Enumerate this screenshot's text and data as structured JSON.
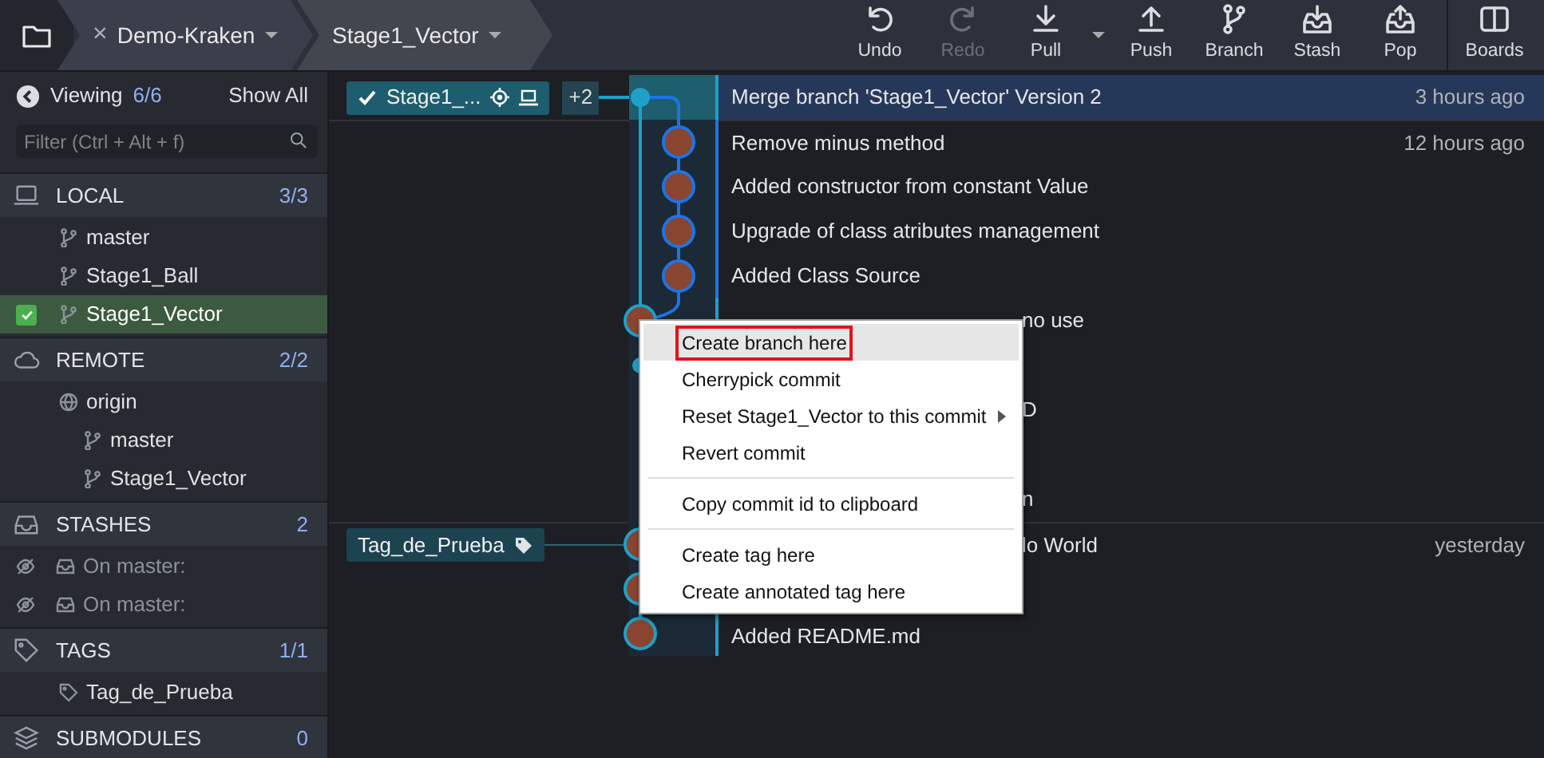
{
  "toolbar": {
    "repo_tab": {
      "close": "×",
      "label": "Demo-Kraken"
    },
    "branch_tab": {
      "label": "Stage1_Vector"
    },
    "actions": [
      {
        "kind": "undo",
        "label": "Undo",
        "disabled": false,
        "menu": false
      },
      {
        "kind": "redo",
        "label": "Redo",
        "disabled": true,
        "menu": false
      },
      {
        "kind": "pull",
        "label": "Pull",
        "disabled": false,
        "menu": true
      },
      {
        "kind": "push",
        "label": "Push",
        "disabled": false,
        "menu": false
      },
      {
        "kind": "branch",
        "label": "Branch",
        "disabled": false,
        "menu": false
      },
      {
        "kind": "stash",
        "label": "Stash",
        "disabled": false,
        "menu": false
      },
      {
        "kind": "pop",
        "label": "Pop",
        "disabled": false,
        "menu": false
      },
      {
        "kind": "boards",
        "label": "Boards",
        "disabled": false,
        "menu": false
      }
    ]
  },
  "sidebar": {
    "viewing": {
      "label": "Viewing",
      "count": "6/6",
      "action": "Show All"
    },
    "filter": {
      "placeholder": "Filter (Ctrl + Alt + f)"
    },
    "sections": [
      {
        "kind": "local",
        "title": "LOCAL",
        "count": "3/3",
        "items": [
          {
            "kind": "branch",
            "label": "master",
            "selected": false
          },
          {
            "kind": "branch",
            "label": "Stage1_Ball",
            "selected": false
          },
          {
            "kind": "branch",
            "label": "Stage1_Vector",
            "selected": true
          }
        ]
      },
      {
        "kind": "remote",
        "title": "REMOTE",
        "count": "2/2",
        "items": [
          {
            "kind": "remote",
            "label": "origin",
            "selected": false,
            "children": [
              {
                "kind": "branch",
                "label": "master",
                "selected": false
              },
              {
                "kind": "branch",
                "label": "Stage1_Vector",
                "selected": false
              }
            ]
          }
        ]
      },
      {
        "kind": "stashes",
        "title": "STASHES",
        "count": "2",
        "items": [
          {
            "kind": "stash",
            "label": "On master:",
            "selected": false
          },
          {
            "kind": "stash",
            "label": "On master:",
            "selected": false
          }
        ]
      },
      {
        "kind": "tags",
        "title": "TAGS",
        "count": "1/1",
        "items": [
          {
            "kind": "tag",
            "label": "Tag_de_Prueba",
            "selected": false
          }
        ]
      },
      {
        "kind": "submodules",
        "title": "SUBMODULES",
        "count": "0"
      }
    ]
  },
  "graph": {
    "commits": [
      {
        "message": "Merge branch 'Stage1_Vector' Version 2",
        "time": "3 hours ago",
        "selected": true,
        "color": "#1fa0c8",
        "kind": "dot",
        "group_start": false,
        "refs": [
          {
            "kind": "branch",
            "label": "Stage1_...",
            "current": true,
            "local": true
          }
        ],
        "more_refs": "+2"
      },
      {
        "message": "Remove minus method",
        "time": "12 hours ago",
        "selected": false,
        "color": "#1d74e6",
        "kind": "avatar",
        "group_start": true
      },
      {
        "message": "Added constructor from constant Value",
        "selected": false,
        "color": "#1d74e6",
        "kind": "avatar",
        "group_start": false
      },
      {
        "message": "Upgrade of class atributes management",
        "selected": false,
        "color": "#1d74e6",
        "kind": "avatar",
        "group_start": false
      },
      {
        "message": "Added Class Source",
        "selected": false,
        "color": "#1d74e6",
        "kind": "avatar",
        "group_start": false
      },
      {
        "message": "no use",
        "selected": false,
        "color": "#1fa0c8",
        "kind": "avatar",
        "group_start": false,
        "covered": true
      },
      {
        "selected": false,
        "color": "#1fa0c8",
        "kind": "dot"
      },
      {
        "message": "D",
        "selected": false,
        "group_start": false,
        "covered": true
      },
      {
        "selected": false
      },
      {
        "message": "n",
        "selected": false,
        "group_start": false,
        "covered": true
      },
      {
        "message": "lo World",
        "time": "yesterday",
        "selected": false,
        "color": "#1fa0c8",
        "kind": "avatar",
        "group_start": true,
        "covered": true,
        "refs": [
          {
            "kind": "tag",
            "label": "Tag_de_Prueba",
            "current": false
          }
        ]
      },
      {
        "selected": false,
        "color": "#1fa0c8",
        "kind": "avatar"
      },
      {
        "message": "Added README.md",
        "selected": false,
        "color": "#1fa0c8",
        "kind": "avatar",
        "group_start": false
      }
    ]
  },
  "context_menu": {
    "items": [
      {
        "kind": "item",
        "label": "Create branch here",
        "selected": true,
        "submenu": false
      },
      {
        "kind": "item",
        "label": "Cherrypick commit",
        "selected": false,
        "submenu": false
      },
      {
        "kind": "item",
        "label": "Reset Stage1_Vector to this commit",
        "selected": false,
        "submenu": true
      },
      {
        "kind": "item",
        "label": "Revert commit",
        "selected": false,
        "submenu": false
      },
      {
        "kind": "separator"
      },
      {
        "kind": "item",
        "label": "Copy commit id to clipboard",
        "selected": false,
        "submenu": false
      },
      {
        "kind": "separator"
      },
      {
        "kind": "item",
        "label": "Create tag here",
        "selected": false,
        "submenu": false
      },
      {
        "kind": "item",
        "label": "Create annotated tag here",
        "selected": false,
        "submenu": false
      }
    ]
  }
}
